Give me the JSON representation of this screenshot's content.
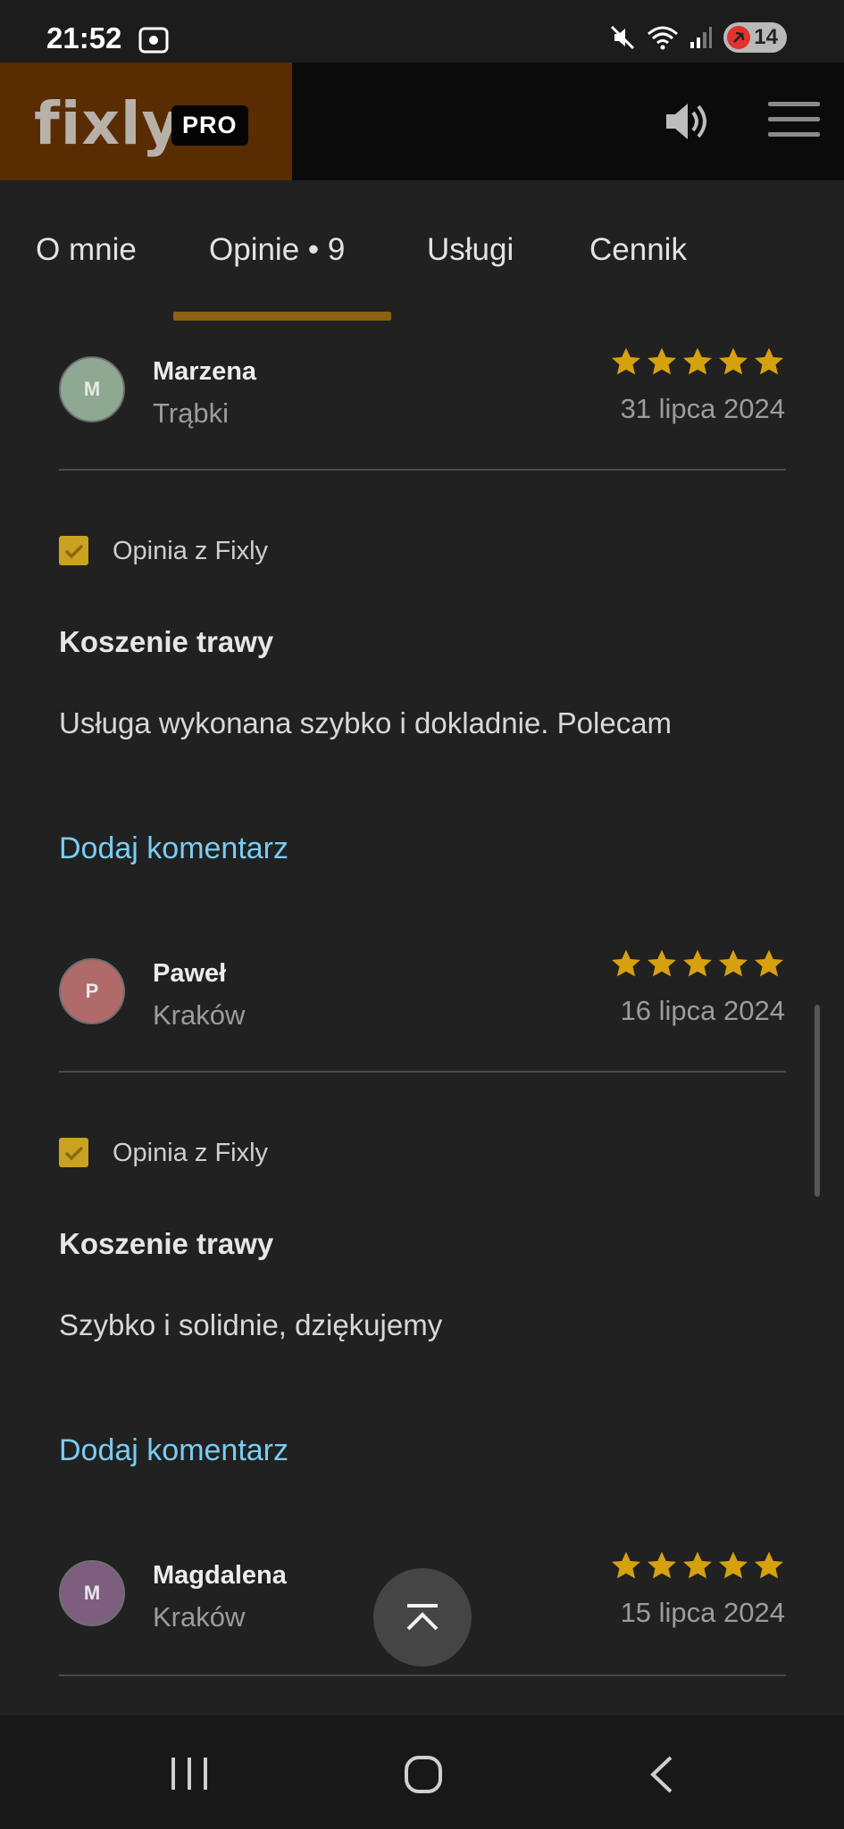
{
  "status": {
    "time": "21:52",
    "battery": "14"
  },
  "header": {
    "logo": "fixly",
    "badge": "PRO"
  },
  "tabs": [
    {
      "label": "O mnie"
    },
    {
      "label": "Opinie • 9",
      "active": true
    },
    {
      "label": "Usługi"
    },
    {
      "label": "Cennik"
    }
  ],
  "reviews": [
    {
      "initial": "M",
      "avatar_color": "#8ea892",
      "name": "Marzena",
      "city": "Trąbki",
      "date": "31 lipca 2024",
      "rating": 5,
      "source_label": "Opinia z Fixly",
      "service": "Koszenie trawy",
      "text": "Usługa wykonana szybko i dokladnie. Polecam",
      "comment_link": "Dodaj komentarz"
    },
    {
      "initial": "P",
      "avatar_color": "#b06a6a",
      "name": "Paweł",
      "city": "Kraków",
      "date": "16 lipca 2024",
      "rating": 5,
      "source_label": "Opinia z Fixly",
      "service": "Koszenie trawy",
      "text": "Szybko i solidnie, dziękujemy",
      "comment_link": "Dodaj komentarz"
    },
    {
      "initial": "M",
      "avatar_color": "#7d5e7f",
      "name": "Magdalena",
      "city": "Kraków",
      "date": "15 lipca 2024",
      "rating": 5
    }
  ],
  "colors": {
    "accent": "#8a6210",
    "star": "#d6a10e",
    "link": "#79cdf2",
    "brand_bg": "#5a2c02"
  }
}
